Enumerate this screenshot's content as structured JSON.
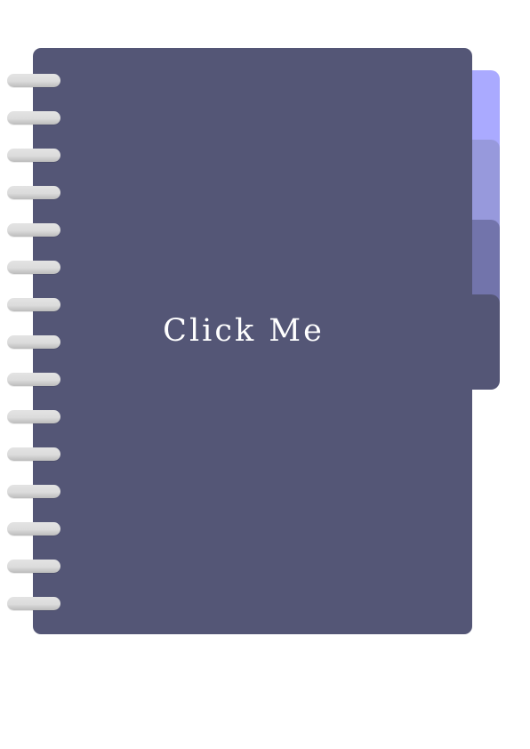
{
  "button": {
    "label": "Click Me"
  },
  "colors": {
    "cover": "#545676",
    "tab_1": "#aaaaff",
    "tab_2": "#9799dc",
    "tab_3": "#7274ab",
    "tab_4": "#545676",
    "ring": "#dcdcdc",
    "label": "#ffffff"
  },
  "icons": {
    "ring": "spiral-ring-icon",
    "ring_count": 15
  }
}
